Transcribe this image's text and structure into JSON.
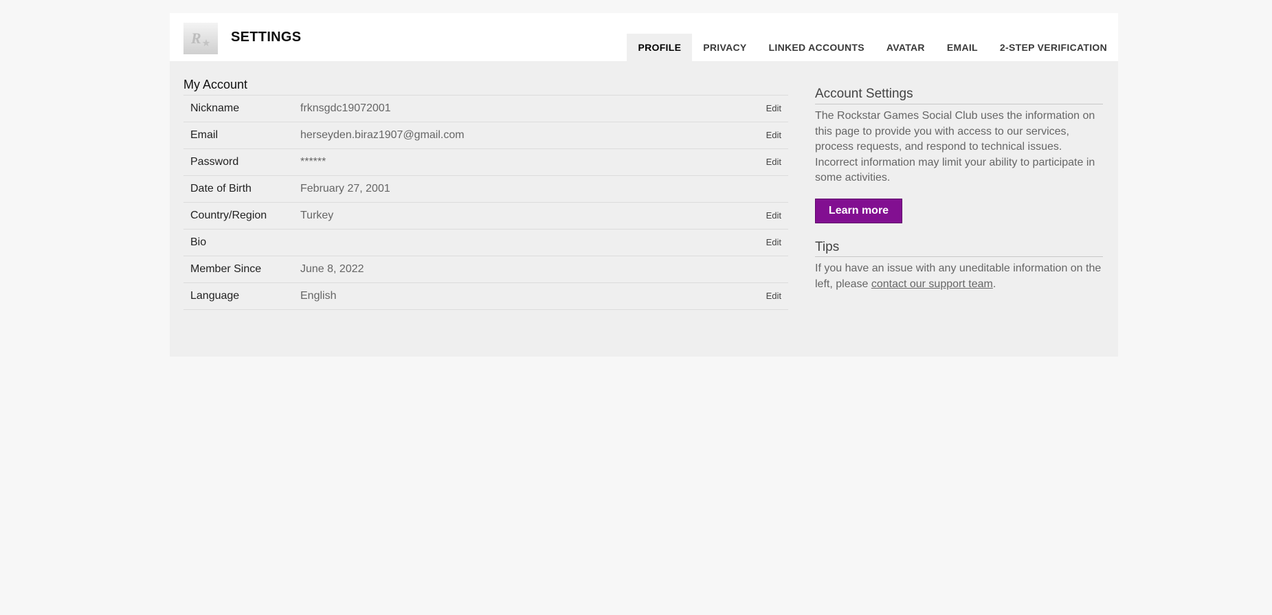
{
  "header": {
    "title": "SETTINGS",
    "logo_icon": "rockstar-logo-icon"
  },
  "tabs": [
    {
      "label": "PROFILE",
      "active": true
    },
    {
      "label": "PRIVACY",
      "active": false
    },
    {
      "label": "LINKED ACCOUNTS",
      "active": false
    },
    {
      "label": "AVATAR",
      "active": false
    },
    {
      "label": "EMAIL",
      "active": false
    },
    {
      "label": "2-STEP VERIFICATION",
      "active": false
    }
  ],
  "account": {
    "title": "My Account",
    "edit_label": "Edit",
    "rows": [
      {
        "label": "Nickname",
        "value": "frknsgdc19072001",
        "editable": true
      },
      {
        "label": "Email",
        "value": "herseyden.biraz1907@gmail.com",
        "editable": true
      },
      {
        "label": "Password",
        "value": "******",
        "editable": true
      },
      {
        "label": "Date of Birth",
        "value": "February 27, 2001",
        "editable": false
      },
      {
        "label": "Country/Region",
        "value": "Turkey",
        "editable": true
      },
      {
        "label": "Bio",
        "value": "",
        "editable": true
      },
      {
        "label": "Member Since",
        "value": "June 8, 2022",
        "editable": false
      },
      {
        "label": "Language",
        "value": "English",
        "editable": true
      }
    ]
  },
  "sidebar": {
    "account_settings_title": "Account Settings",
    "account_settings_text": "The Rockstar Games Social Club uses the information on this page to provide you with access to our services, process requests, and respond to technical issues. Incorrect information may limit your ability to participate in some activities.",
    "learn_more_label": "Learn more",
    "tips_title": "Tips",
    "tips_text_before": "If you have an issue with any uneditable information on the left, please ",
    "tips_link": "contact our support team",
    "tips_text_after": "."
  },
  "colors": {
    "accent": "#820f91",
    "page_bg": "#f7f7f7",
    "panel_bg": "#efefef"
  }
}
